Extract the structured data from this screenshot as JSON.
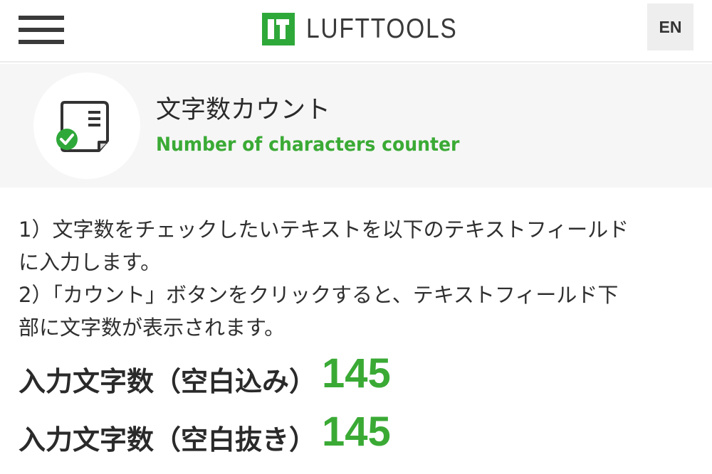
{
  "header": {
    "logo_text": "LUFTTOOLS",
    "language_button": "EN",
    "menu_icon": "hamburger-menu-icon",
    "brand_color": "#3aaa35"
  },
  "tool": {
    "icon": "document-check-icon",
    "title_jp": "文字数カウント",
    "title_en": "Number of characters counter"
  },
  "instructions": {
    "line1": "1）文字数をチェックしたいテキストを以下のテキストフィールド",
    "line2": "に入力します。",
    "line3": "2）「カウント」ボタンをクリックすると、テキストフィールド下",
    "line4": "部に文字数が表示されます。"
  },
  "counts": [
    {
      "label": "入力文字数（空白込み）",
      "value": "145"
    },
    {
      "label": "入力文字数（空白抜き）",
      "value": "145"
    }
  ]
}
